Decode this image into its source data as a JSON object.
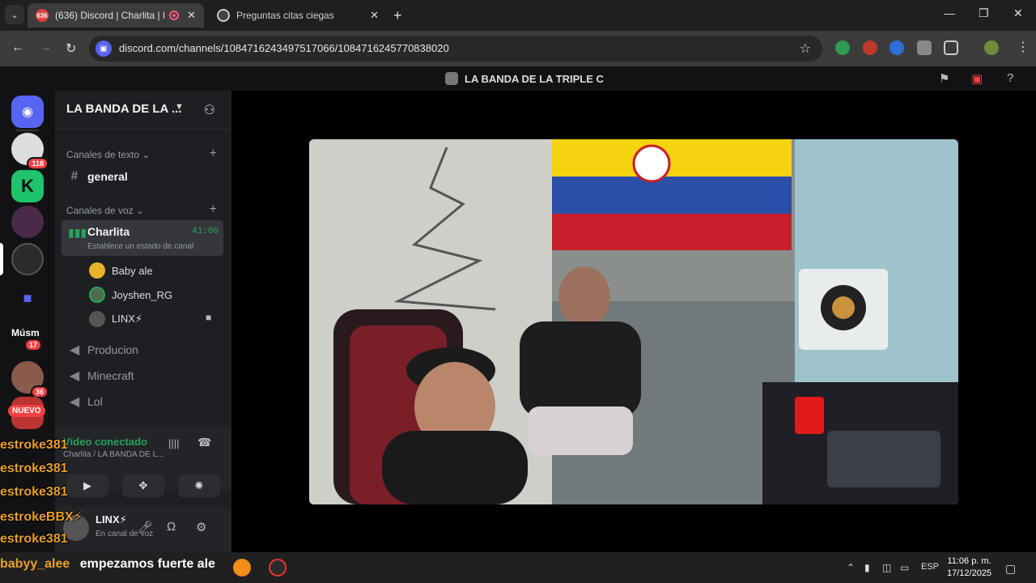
{
  "browser": {
    "tabs": [
      {
        "title": "(636) Discord | Charlita | LA",
        "badge": "636",
        "recording": true
      },
      {
        "title": "Preguntas citas ciegas",
        "recording": false
      }
    ],
    "url": "discord.com/channels/1084716243497517066/1084716245770838020"
  },
  "discord": {
    "title": "LA BANDA DE LA TRIPLE C",
    "guild_name": "LA BANDA DE LA ...",
    "rail_badges": [
      "118",
      "17",
      "36"
    ],
    "rail_label": "Músm",
    "nuevo": "NUEVO",
    "text_category": "Canales de texto",
    "text_channels": [
      "general"
    ],
    "voice_category": "Canales de voz",
    "active_voice": {
      "name": "Charlita",
      "timer": "41:06",
      "status": "Establece un estado de canal",
      "members": [
        "Baby ale",
        "Joyshen_RG",
        "LINX⚡"
      ]
    },
    "voice_channels": [
      "Producion",
      "Minecraft",
      "Lol"
    ],
    "voice_panel": {
      "title": "Vídeo conectado",
      "subtitle": "Charlita / LA BANDA DE L..."
    },
    "user_panel": {
      "name": "LINX⚡",
      "status": "En canal de voz"
    }
  },
  "chat_overlay": {
    "lines": [
      "estroke381",
      "estroke381",
      "estroke381",
      "estrokeBBX⚡",
      "estroke381"
    ],
    "last_user": "babyy_alee",
    "last_message": "empezamos fuerte ale"
  },
  "taskbar": {
    "lang": "ESP",
    "time": "11:06 p. m.",
    "date": "17/12/2025"
  },
  "colors": {
    "discord_accent": "#5865f2",
    "voice_green": "#23a55a",
    "chat_orange": "#e8a12a"
  }
}
